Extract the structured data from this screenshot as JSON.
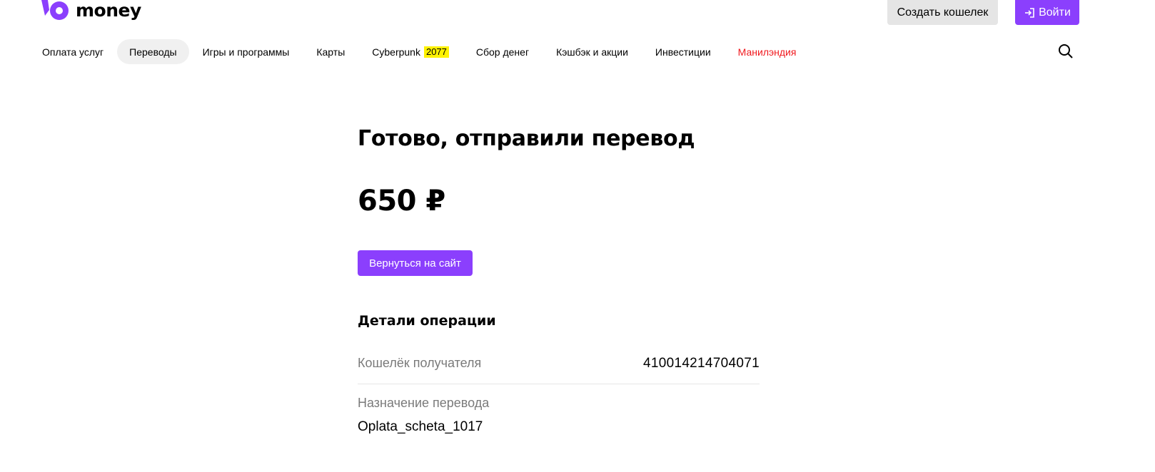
{
  "header": {
    "logo_text": "money",
    "create_wallet_label": "Создать кошелек",
    "login_label": "Войти",
    "brand_color": "#8b3ffd"
  },
  "nav": {
    "items": [
      {
        "label": "Оплата услуг"
      },
      {
        "label": "Переводы",
        "active": true
      },
      {
        "label": "Игры и программы"
      },
      {
        "label": "Карты"
      },
      {
        "label": "Cyberpunk",
        "tag": "2077"
      },
      {
        "label": "Сбор денег"
      },
      {
        "label": "Кэшбэк и акции"
      },
      {
        "label": "Инвестиции"
      },
      {
        "label": "Манилэндия",
        "color": "#f0191e"
      }
    ]
  },
  "icons": {
    "search": "search-icon",
    "login": "login-icon",
    "logo": "yoomoney-logo-icon"
  },
  "main": {
    "title": "Готово, отправили перевод",
    "amount": "650 ₽",
    "back_button_label": "Вернуться на сайт",
    "details_title": "Детали операции",
    "recipient_wallet_label": "Кошелёк получателя",
    "recipient_wallet_value": "410014214704071",
    "purpose_label": "Назначение перевода",
    "purpose_value": "Oplata_scheta_1017"
  }
}
